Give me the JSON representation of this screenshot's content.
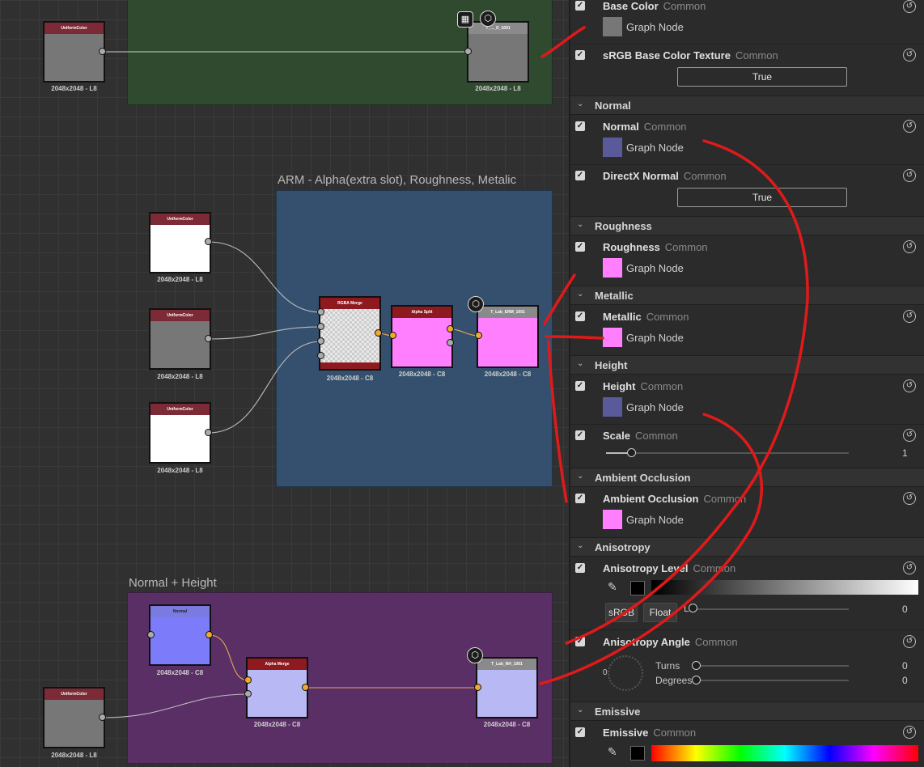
{
  "graph": {
    "frames": {
      "arm_title": "ARM - Alpha(extra slot), Roughness, Metalic",
      "normal_title": "Normal + Height"
    },
    "nodes": {
      "uc1": {
        "title": "UniformColor",
        "res": "2048x2048 - L8"
      },
      "out_bc": {
        "title": "T_..._D_1001",
        "res": "2048x2048 - L8"
      },
      "uc2": {
        "title": "UniformColor",
        "res": "2048x2048 - L8"
      },
      "uc3": {
        "title": "UniformColor",
        "res": "2048x2048 - L8"
      },
      "uc4": {
        "title": "UniformColor",
        "res": "2048x2048 - L8"
      },
      "rgba": {
        "title": "RGBA Merge",
        "res": "2048x2048 - C8"
      },
      "asplit": {
        "title": "Alpha Split",
        "res": "2048x2048 - C8"
      },
      "out_arm": {
        "title": "T_Lab_ERM_1001",
        "res": "2048x2048 - C8"
      },
      "normal": {
        "title": "Normal",
        "res": "2048x2048 - C8"
      },
      "amerge": {
        "title": "Alpha Merge",
        "res": "2048x2048 - C8"
      },
      "out_nh": {
        "title": "T_Lab_NH_1001",
        "res": "2048x2048 - C8"
      },
      "uc5": {
        "title": "UniformColor",
        "res": "2048x2048 - L8"
      }
    }
  },
  "panel": {
    "common": "Common",
    "graph_node": "Graph Node",
    "true_label": "True",
    "sections": {
      "normal": "Normal",
      "roughness": "Roughness",
      "metallic": "Metallic",
      "height": "Height",
      "ao": "Ambient Occlusion",
      "anisotropy": "Anisotropy",
      "emissive": "Emissive"
    },
    "props": {
      "base_color": "Base Color",
      "srgb_texture": "sRGB Base Color Texture",
      "normal": "Normal",
      "directx_normal": "DirectX Normal",
      "roughness": "Roughness",
      "metallic": "Metallic",
      "height": "Height",
      "scale": "Scale",
      "ao": "Ambient Occlusion",
      "aniso_level": "Anisotropy Level",
      "aniso_angle": "Anisotropy Angle",
      "emissive": "Emissive"
    },
    "values": {
      "scale": "1",
      "aniso_level": "0",
      "turns": "0",
      "degrees": "0",
      "angle_dial": "0",
      "level_prefix": "L"
    },
    "labels": {
      "srgb": "sRGB",
      "float": "Float",
      "turns": "Turns",
      "degrees": "Degrees"
    }
  },
  "colors": {
    "frame_green": "#2f4a2f",
    "frame_blue": "#34506e",
    "frame_purple": "#5a2f66",
    "node_header": "#7c2a35",
    "node_header_red": "#8e1a20",
    "node_header_blue": "#7a7ae0",
    "pink": "#ff7fff",
    "normal_blue": "#7c7cfa",
    "graph_node_purple": "#5a5a9a",
    "annotation_red": "#e01a1a"
  }
}
